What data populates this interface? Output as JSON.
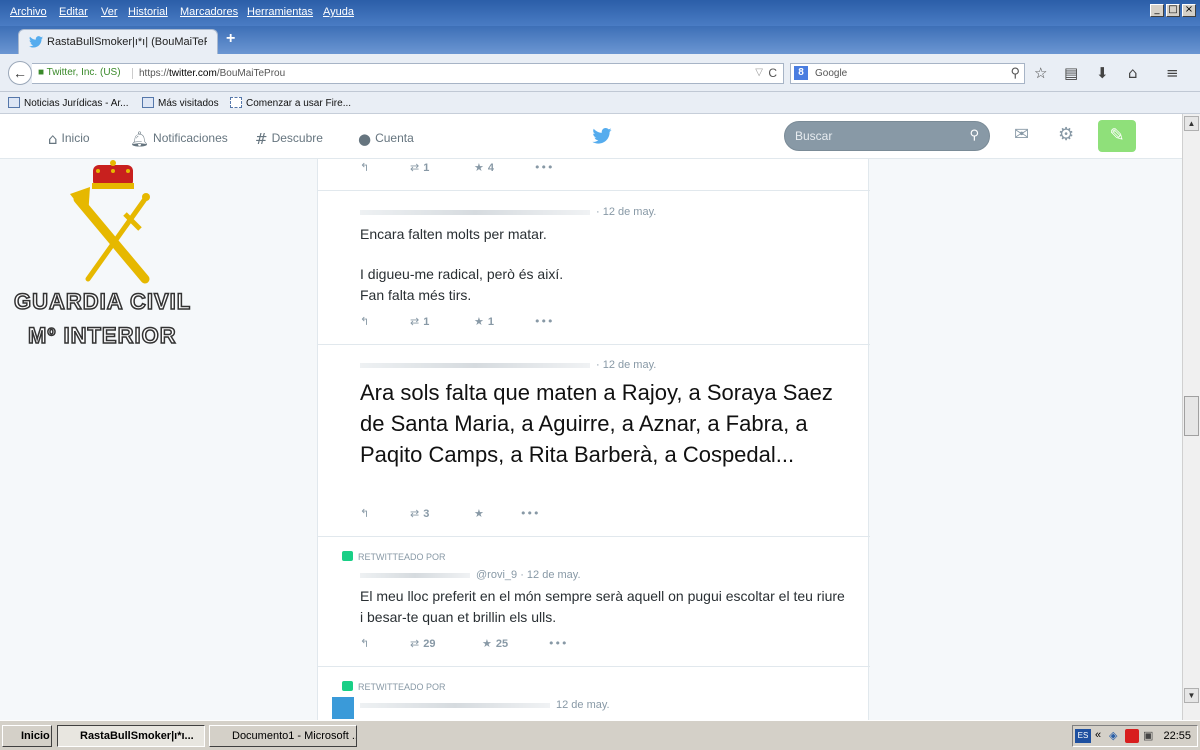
{
  "window": {
    "menu": [
      "Archivo",
      "Editar",
      "Ver",
      "Historial",
      "Marcadores",
      "Herramientas",
      "Ayuda"
    ],
    "controls": [
      "_",
      "□",
      "×"
    ]
  },
  "tab": {
    "title": "RastaBullSmoker|ı*ı| (BouMaiTePr...",
    "new_tab": "+"
  },
  "navbar": {
    "back": "←",
    "identity": "Twitter, Inc. (US)",
    "url_prefix": "https://",
    "url_domain": "twitter.com",
    "url_path": "/BouMaiTeProu",
    "reload": "C",
    "search_engine": "8",
    "search_placeholder": "Google"
  },
  "bookmarks": [
    {
      "label": "Noticias Jurídicas - Ar..."
    },
    {
      "label": "Más visitados"
    },
    {
      "label": "Comenzar a usar Fire..."
    }
  ],
  "twitter_nav": {
    "home": "Inicio",
    "notifications": "Notificaciones",
    "discover": "Descubre",
    "account": "Cuenta",
    "search_placeholder": "Buscar"
  },
  "logo": {
    "line1": "GUARDIA CIVIL",
    "line2": "Mº INTERIOR"
  },
  "tweets": [
    {
      "date": "",
      "text": "",
      "retweets": "1",
      "favorites": "4"
    },
    {
      "date": "· 12 de may.",
      "text": "Encara falten molts per matar.",
      "text2": "I digueu-me radical, però és així.",
      "text3": "Fan falta més tirs.",
      "retweets": "1",
      "favorites": "1"
    },
    {
      "date": "· 12 de may.",
      "text": "Ara sols falta que maten a Rajoy, a Soraya Saez de Santa Maria, a Aguirre, a Aznar, a Fabra, a Paqito Camps, a Rita Barberà, a Cospedal...",
      "retweets": "3",
      "favorites": ""
    },
    {
      "rt_label": "RETWITTEADO POR",
      "handle": "@rovi_9",
      "date": "· 12 de may.",
      "text": "El meu lloc preferit en el món sempre serà aquell on pugui escoltar el teu riure i besar-te quan et brillin els ulls.",
      "retweets": "29",
      "favorites": "25"
    },
    {
      "rt_label": "RETWITTEADO POR",
      "date": "12 de may."
    }
  ],
  "taskbar": {
    "start": "Inicio",
    "tasks": [
      "RastaBullSmoker|ı*ı...",
      "Documento1 - Microsoft ..."
    ],
    "lang": "ES",
    "chevron": "«",
    "clock": "22:55"
  }
}
